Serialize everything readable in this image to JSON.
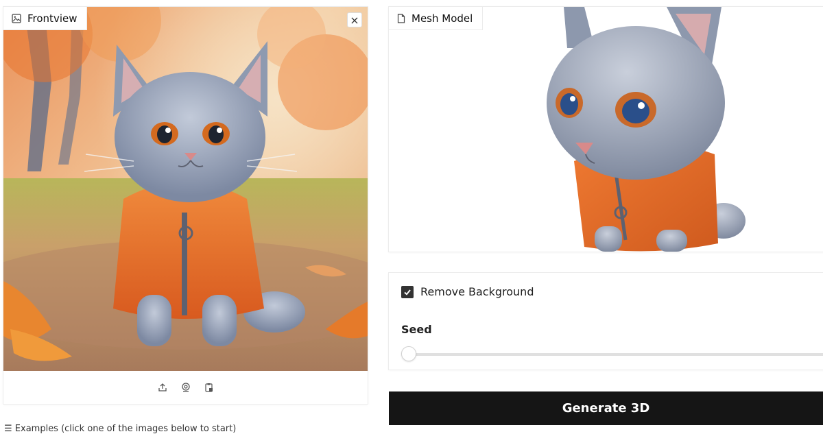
{
  "frontview": {
    "label": "Frontview",
    "image_icon": "image-icon",
    "close_symbol": "×",
    "toolbar": [
      "upload-icon",
      "webcam-icon",
      "clipboard-paste-icon"
    ]
  },
  "mesh": {
    "label": "Mesh Model",
    "file_icon": "file-icon"
  },
  "controls": {
    "remove_background_label": "Remove Background",
    "remove_background_checked": true,
    "seed_label": "Seed",
    "seed_value": 0
  },
  "generate_label": "Generate 3D",
  "examples_text": "☰ Examples (click one of the images below to start)",
  "colors": {
    "accent_dark": "#151515",
    "sweater_orange": "#e8692a",
    "cat_gray": "#8e9ab0"
  }
}
